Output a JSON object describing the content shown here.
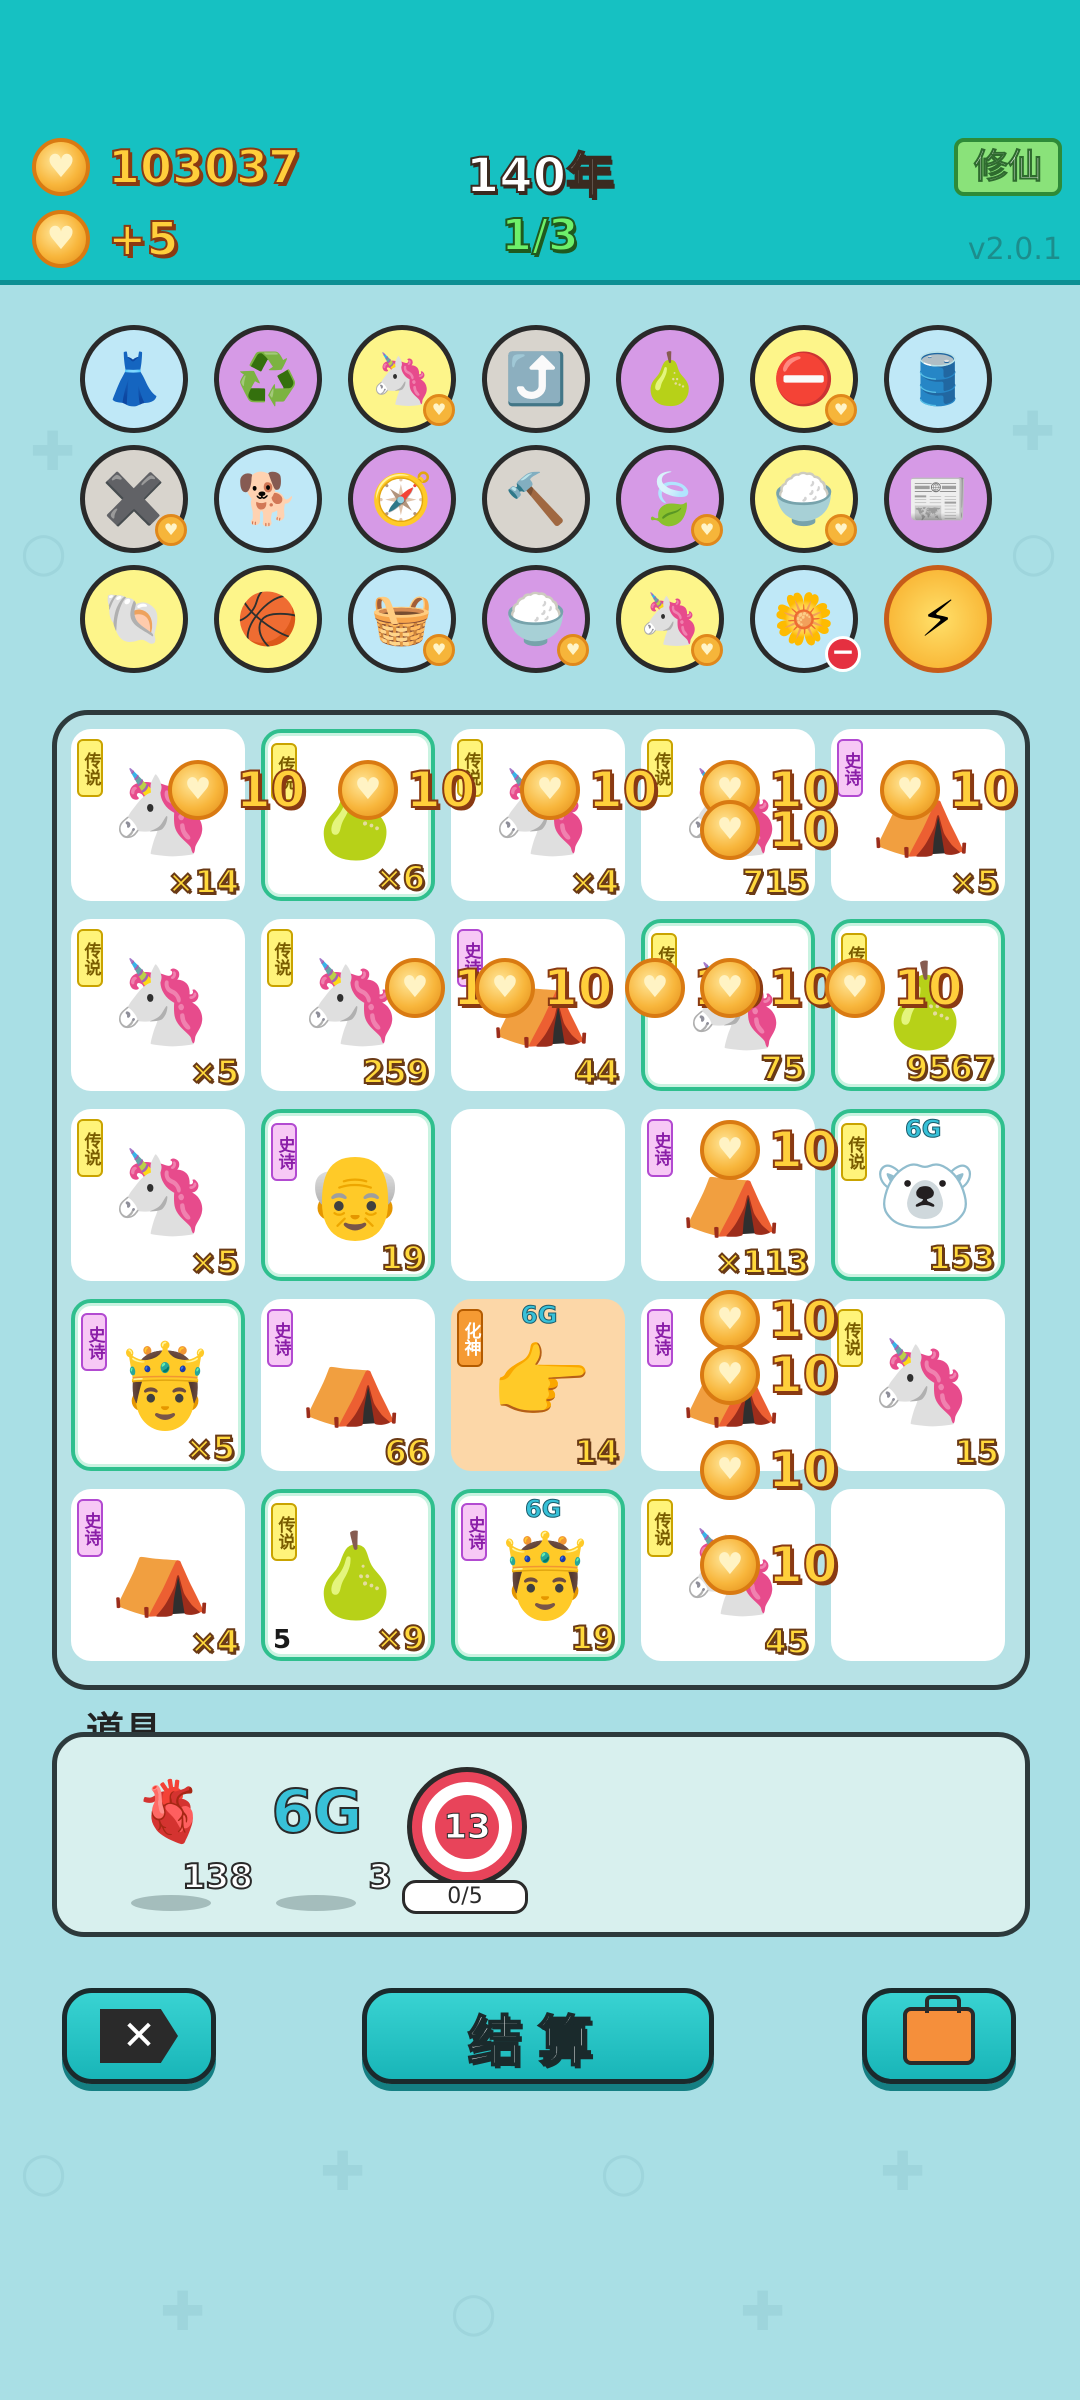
{
  "header": {
    "coins": "103037",
    "income": "+5",
    "year": "140年",
    "round": "1/3",
    "cultivate_label": "修仙",
    "version": "v2.0.1"
  },
  "inventory": {
    "rows": [
      [
        {
          "name": "skirt-icon",
          "glyph": "👗",
          "bg": "blue",
          "coin": false
        },
        {
          "name": "recycle-icon",
          "glyph": "♻️",
          "bg": "purple",
          "coin": false
        },
        {
          "name": "unicorn-icon",
          "glyph": "🦄",
          "bg": "yellow",
          "coin": true
        },
        {
          "name": "arrow-card-icon",
          "glyph": "⤴️",
          "bg": "grey",
          "coin": false
        },
        {
          "name": "pomelo-icon",
          "glyph": "🍐",
          "bg": "purple",
          "coin": false
        },
        {
          "name": "no-entry-icon",
          "glyph": "⛔",
          "bg": "yellow",
          "coin": true
        },
        {
          "name": "pump-icon",
          "glyph": "🛢️",
          "bg": "blue",
          "coin": false
        }
      ],
      [
        {
          "name": "remove-tag-icon",
          "glyph": "✖️",
          "bg": "grey",
          "coin": true
        },
        {
          "name": "dog-icon",
          "glyph": "🐕",
          "bg": "blue",
          "coin": false
        },
        {
          "name": "compass-icon",
          "glyph": "🧭",
          "bg": "purple",
          "coin": false
        },
        {
          "name": "hammer-icon",
          "glyph": "🔨",
          "bg": "grey",
          "coin": false
        },
        {
          "name": "leaf-icon",
          "glyph": "🍃",
          "bg": "purple",
          "coin": true
        },
        {
          "name": "rice-bowl-icon",
          "glyph": "🍚",
          "bg": "yellow",
          "coin": true
        },
        {
          "name": "time-magazine-icon",
          "glyph": "📰",
          "bg": "purple",
          "coin": false
        }
      ],
      [
        {
          "name": "shell-icon",
          "glyph": "🐚",
          "bg": "yellow",
          "coin": false
        },
        {
          "name": "basketballs-icon",
          "glyph": "🏀",
          "bg": "yellow",
          "coin": false
        },
        {
          "name": "fruit-basket-icon",
          "glyph": "🧺",
          "bg": "blue",
          "coin": true
        },
        {
          "name": "rice-bowl-icon",
          "glyph": "🍚",
          "bg": "purple",
          "coin": true
        },
        {
          "name": "unicorn-icon",
          "glyph": "🦄",
          "bg": "yellow",
          "coin": true
        },
        {
          "name": "flower-pot-icon",
          "glyph": "🌼",
          "bg": "blue",
          "minus": true
        },
        {
          "name": "energy-icon",
          "glyph": "⚡",
          "bg": "energy",
          "coin": false
        }
      ]
    ]
  },
  "tag_legend": "传说",
  "tag_epic": "史诗",
  "tag_orange": "化神",
  "badge_6g": "6G",
  "float_value": "10",
  "board": [
    {
      "row": 0,
      "col": 0,
      "rarity": "legend",
      "glyph": "🦄",
      "count": "×14"
    },
    {
      "row": 0,
      "col": 1,
      "rarity": "legend",
      "glyph": "🍐",
      "count": "×6",
      "glow": true
    },
    {
      "row": 0,
      "col": 2,
      "rarity": "legend",
      "glyph": "🦄",
      "count": "×4"
    },
    {
      "row": 0,
      "col": 3,
      "rarity": "legend",
      "glyph": "🦄",
      "count": "715"
    },
    {
      "row": 0,
      "col": 4,
      "rarity": "epic",
      "glyph": "⛺",
      "count": "×5"
    },
    {
      "row": 1,
      "col": 0,
      "rarity": "legend",
      "glyph": "🦄",
      "count": "×5"
    },
    {
      "row": 1,
      "col": 1,
      "rarity": "legend",
      "glyph": "🦄",
      "count": "259"
    },
    {
      "row": 1,
      "col": 2,
      "rarity": "epic",
      "glyph": "⛺",
      "count": "44"
    },
    {
      "row": 1,
      "col": 3,
      "rarity": "legend",
      "glyph": "🦄",
      "count": "75",
      "glow": true
    },
    {
      "row": 1,
      "col": 4,
      "rarity": "legend",
      "glyph": "🍐",
      "count": "9567",
      "glow": true
    },
    {
      "row": 2,
      "col": 0,
      "rarity": "legend",
      "glyph": "🦄",
      "count": "×5"
    },
    {
      "row": 2,
      "col": 1,
      "rarity": "epic",
      "glyph": "👴",
      "count": "19",
      "glow": true
    },
    {
      "row": 2,
      "col": 2,
      "empty": true
    },
    {
      "row": 2,
      "col": 3,
      "rarity": "epic",
      "glyph": "⛺",
      "count": "×113"
    },
    {
      "row": 2,
      "col": 4,
      "rarity": "legend",
      "glyph": "🐻‍❄️",
      "count": "153",
      "glow": true,
      "g6": true
    },
    {
      "row": 3,
      "col": 0,
      "rarity": "epic",
      "glyph": "🤴",
      "count": "×5",
      "glow": true
    },
    {
      "row": 3,
      "col": 1,
      "rarity": "epic",
      "glyph": "⛺",
      "count": "66"
    },
    {
      "row": 3,
      "col": 2,
      "rarity": "orange",
      "glyph": "👉",
      "count": "14",
      "orange": true,
      "g6": true
    },
    {
      "row": 3,
      "col": 3,
      "rarity": "epic",
      "glyph": "⛺",
      "count": ""
    },
    {
      "row": 3,
      "col": 4,
      "rarity": "legend",
      "glyph": "🦄",
      "count": "15"
    },
    {
      "row": 4,
      "col": 0,
      "rarity": "epic",
      "glyph": "⛺",
      "count": "×4"
    },
    {
      "row": 4,
      "col": 1,
      "rarity": "legend",
      "glyph": "🍐",
      "count": "×9",
      "glow": true,
      "left": "5"
    },
    {
      "row": 4,
      "col": 2,
      "rarity": "epic",
      "glyph": "🤴",
      "count": "19",
      "glow": true,
      "g6": true
    },
    {
      "row": 4,
      "col": 3,
      "rarity": "legend",
      "glyph": "🦄",
      "count": "45"
    },
    {
      "row": 4,
      "col": 4,
      "empty": true
    }
  ],
  "items": {
    "title": "道具",
    "list": [
      {
        "name": "liver-item",
        "glyph": "🫀",
        "count": "138"
      },
      {
        "name": "6g-item",
        "glyph": "6G",
        "count": "3"
      }
    ],
    "target_value": "13",
    "target_progress": "0/5"
  },
  "buttons": {
    "settle_label": "结算"
  }
}
